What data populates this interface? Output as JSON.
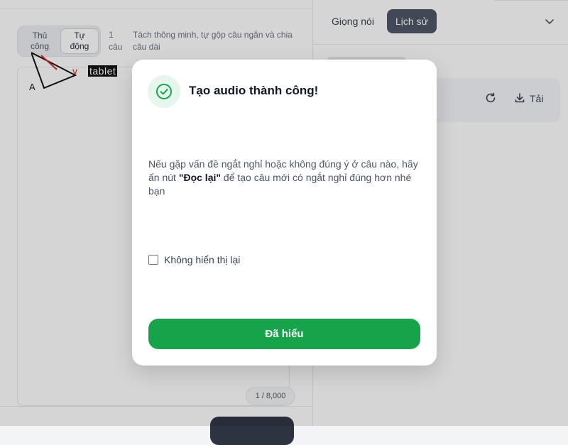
{
  "editor": {
    "mode_manual": "Thủ công",
    "mode_auto": "Tự động",
    "sentence_count": "1 câu",
    "mode_description": "Tách thông minh, tự gộp câu ngắn và chia câu dài",
    "text": "A",
    "char_counter": "1 / 8,000"
  },
  "watermark": {
    "prefix": "v",
    "text": "tablet"
  },
  "right_panel": {
    "tab_voice": "Giọng nói",
    "tab_history": "Lịch sử",
    "download_label": "Tải"
  },
  "modal": {
    "title": "Tạo audio thành công!",
    "body_before": "Nếu gặp vấn đề ngắt nghỉ hoặc không đúng ý ở câu nào, hãy ấn nút ",
    "body_highlight": "\"Đọc lại\"",
    "body_after": " để tạo câu mới có ngắt nghỉ đúng hơn nhé bạn",
    "checkbox_label": "Không hiển thị lại",
    "ok_button": "Đã hiểu"
  },
  "colors": {
    "primary_green": "#16a34a",
    "success_bg": "#e7f6ec",
    "dark_tab": "#4b5563"
  },
  "icons": {
    "success": "check-circle-icon",
    "refresh": "refresh-icon",
    "download": "download-icon",
    "chevron": "chevron-down-icon"
  }
}
